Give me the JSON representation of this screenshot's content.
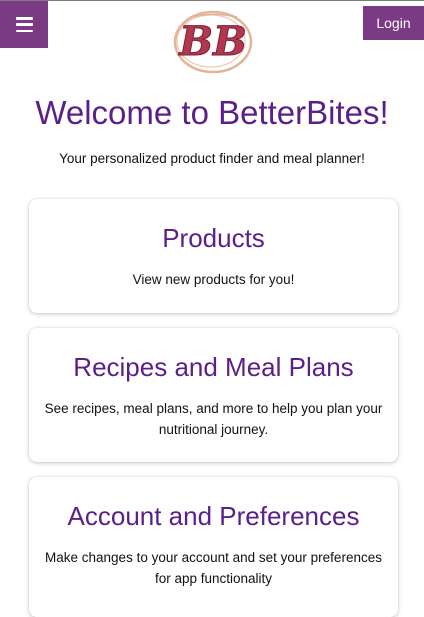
{
  "header": {
    "menu_icon": "hamburger-menu-icon",
    "logo_text": "BB",
    "login_label": "Login"
  },
  "colors": {
    "brand_purple": "#7b3a84",
    "heading_purple": "#5b1f8a",
    "logo_red": "#b2384f",
    "logo_ring": "#e2b59a"
  },
  "main": {
    "title": "Welcome to BetterBites!",
    "tagline": "Your personalized product finder and meal planner!"
  },
  "cards": [
    {
      "title": "Products",
      "description": "View new products for you!"
    },
    {
      "title": "Recipes and Meal Plans",
      "description": "See recipes, meal plans, and more to help you plan your nutritional journey."
    },
    {
      "title": "Account and Preferences",
      "description": "Make changes to your account and set your preferences for app functionality"
    }
  ]
}
